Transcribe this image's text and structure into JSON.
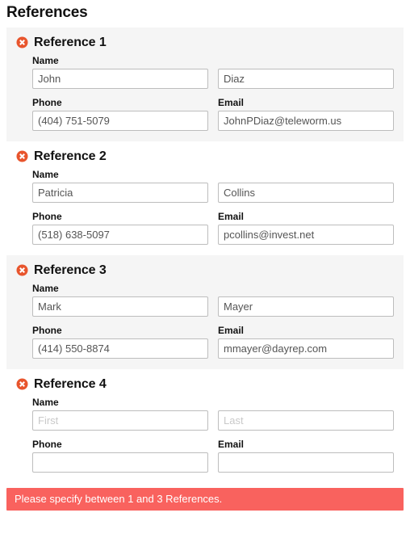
{
  "page": {
    "title": "References"
  },
  "icons": {
    "remove": "remove-circle-icon"
  },
  "labels": {
    "name": "Name",
    "phone": "Phone",
    "email": "Email"
  },
  "placeholders": {
    "first": "First",
    "last": "Last",
    "phone": "",
    "email": ""
  },
  "colors": {
    "remove_icon": "#e8552d",
    "alert_background": "#f9625e",
    "alert_text": "#ffffff",
    "panel_striped": "#f5f5f5",
    "input_border": "#bdbdbd",
    "input_text": "#555555",
    "placeholder_text": "#c9c9c9"
  },
  "references": [
    {
      "title": "Reference 1",
      "striped": true,
      "first": "John",
      "last": "Diaz",
      "phone": "(404) 751-5079",
      "email": "JohnPDiaz@teleworm.us"
    },
    {
      "title": "Reference 2",
      "striped": false,
      "first": "Patricia",
      "last": "Collins",
      "phone": "(518) 638-5097",
      "email": "pcollins@invest.net"
    },
    {
      "title": "Reference 3",
      "striped": true,
      "first": "Mark",
      "last": "Mayer",
      "phone": "(414) 550-8874",
      "email": "mmayer@dayrep.com"
    },
    {
      "title": "Reference 4",
      "striped": false,
      "first": "",
      "last": "",
      "phone": "",
      "email": ""
    }
  ],
  "alert": {
    "message": "Please specify between 1 and 3 References."
  }
}
